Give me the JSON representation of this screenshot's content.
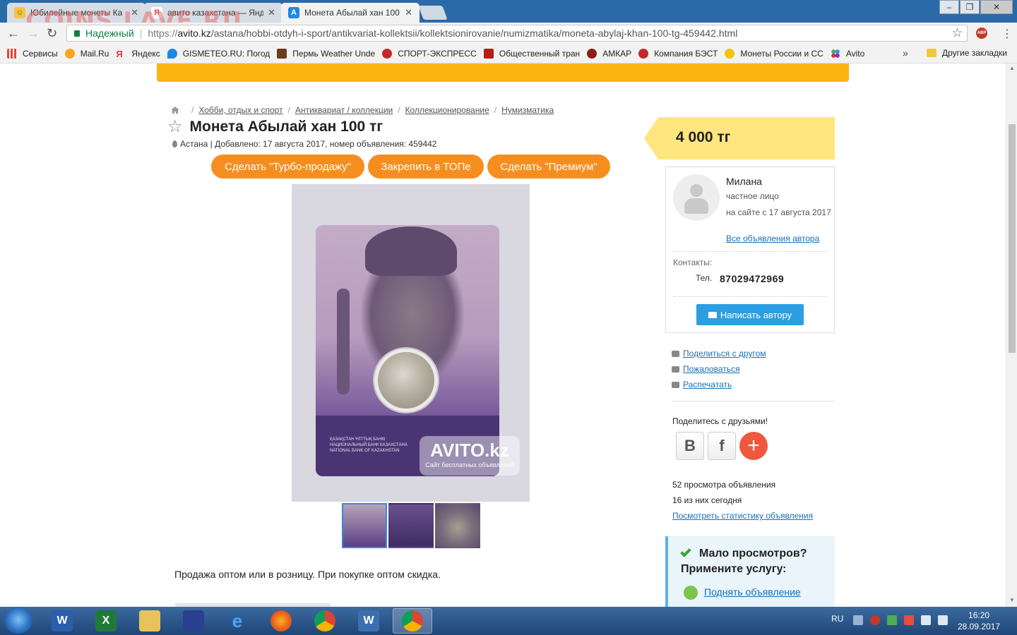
{
  "browser": {
    "tabs": [
      {
        "title": "Юбилейные монеты Ка",
        "icon": "smiley-icon"
      },
      {
        "title": "авито казахстана — Янд",
        "icon": "yandex-icon"
      },
      {
        "title": "Монета Абылай хан 100",
        "icon": "avito-icon"
      }
    ],
    "tab_close": "✕",
    "secure_label": "Надежный",
    "url_proto": "https://",
    "url_host": "avito.kz",
    "url_path": "/astana/hobbi-otdyh-i-sport/antikvariat-kollektsii/kollektsionirovanie/numizmatika/moneta-abylaj-khan-100-tg-459442.html",
    "bookmarks": [
      {
        "label": "Сервисы",
        "color": "#e04a3f"
      },
      {
        "label": "Mail.Ru",
        "color": "#f5a623"
      },
      {
        "label": "Яндекс",
        "color": "#e53935"
      },
      {
        "label": "GISMETEO.RU: Погод",
        "color": "#1e88e5"
      },
      {
        "label": "Пермь Weather Undе",
        "color": "#6d3b1f"
      },
      {
        "label": "СПОРТ-ЭКСПРЕСС",
        "color": "#c62828"
      },
      {
        "label": "Общественный тран",
        "color": "#b71c1c"
      },
      {
        "label": "АМКАР",
        "color": "#8e1b1b"
      },
      {
        "label": "Компания БЭСТ",
        "color": "#c62828"
      },
      {
        "label": "Монеты России и СС",
        "color": "#f1c40f"
      },
      {
        "label": "Avito",
        "color": "#4caf50"
      }
    ],
    "bookmarks_more": "»",
    "other_bookmarks": "Другие закладки",
    "watermark": "COINS.LAVE.RU"
  },
  "page": {
    "breadcrumbs": [
      "Хобби, отдых и спорт",
      "Антиквариат / коллекции",
      "Коллекционирование",
      "Нумизматика"
    ],
    "breadcrumb_sep": "/",
    "title": "Монета Абылай хан 100 тг",
    "meta": "Астана | Добавлено: 17 августа 2017, номер объявления: 459442",
    "promo_buttons": [
      "Сделать \"Турбо-продажу\"",
      "Закрепить в ТОПе",
      "Сделать \"Премиум\""
    ],
    "photo_watermark_big": "AVITO.kz",
    "photo_watermark_small": "Сайт бесплатных объявлений",
    "card_text": "ҚАЗАҚСТАН ҰЛТТЫҚ БАНКІ\nНАЦИОНАЛЬНЫЙ БАНК КАЗАХСТАНА\nNATIONAL BANK OF KAZAKHSTAN",
    "description": "Продажа оптом или в розницу. При покупке оптом скидка."
  },
  "sidebar": {
    "price": "4 000 тг",
    "seller_name": "Милана",
    "seller_type": "частное лицо",
    "seller_since": "на сайте с 17 августа 2017",
    "all_ads_link": "Все объявления автора",
    "contacts_label": "Контакты:",
    "tel_label": "Тел.",
    "phone": "87029472969",
    "write_button": "Написать автору",
    "links": [
      "Поделиться с другом",
      "Пожаловаться",
      "Распечатать"
    ],
    "share_label": "Поделитесь с друзьями!",
    "share_vk": "В",
    "share_fb": "f",
    "share_plus": "+",
    "views_total": "52 просмотра объявления",
    "views_today": "16 из них сегодня",
    "stats_link": "Посмотреть статистику объявления",
    "boost_heading": "Мало просмотров? Примените услугу:",
    "boost_link": "Поднять объявление"
  },
  "taskbar": {
    "lang": "RU",
    "time": "16:20",
    "date": "28.09.2017"
  }
}
